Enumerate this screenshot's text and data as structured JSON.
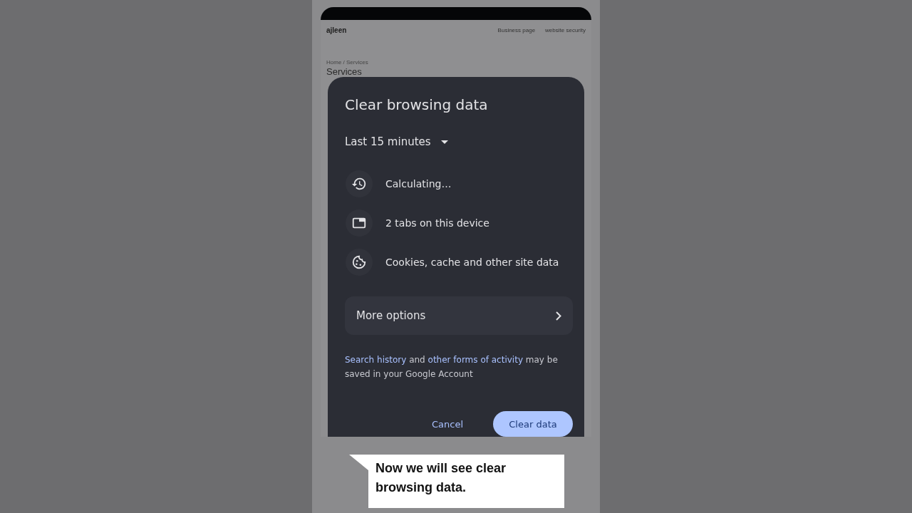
{
  "background_page": {
    "site_name": "ajleen",
    "nav_links": [
      "Business page",
      "website security"
    ],
    "breadcrumb": "Home / Services",
    "heading": "Services"
  },
  "dialog": {
    "title": "Clear browsing data",
    "time_range": "Last 15 minutes",
    "items": [
      {
        "kind": "history",
        "label": "Calculating…"
      },
      {
        "kind": "tabs",
        "label": "2 tabs on this device"
      },
      {
        "kind": "cookies",
        "label": "Cookies, cache and other site data"
      }
    ],
    "more_options": "More options",
    "footer_note": [
      {
        "text": "Search history",
        "link": true
      },
      {
        "text": " and ",
        "link": false
      },
      {
        "text": "other forms of activity",
        "link": true
      },
      {
        "text": " may be saved in your Google Account",
        "link": false
      }
    ],
    "buttons": [
      {
        "kind": "text",
        "label": "Cancel"
      },
      {
        "kind": "filled",
        "label": "Clear data"
      }
    ]
  },
  "caption": "Now we will see clear browsing data."
}
